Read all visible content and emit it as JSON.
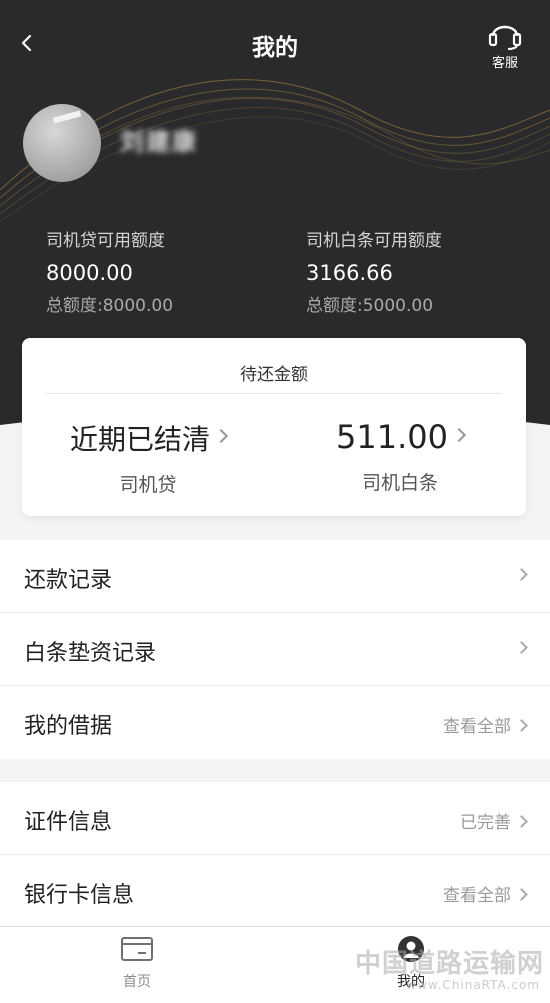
{
  "header": {
    "title": "我的",
    "service_label": "客服",
    "username": "刘建康"
  },
  "credit": {
    "loan": {
      "label": "司机贷可用额度",
      "value": "8000.00",
      "total": "总额度:8000.00"
    },
    "baitiao": {
      "label": "司机白条可用额度",
      "value": "3166.66",
      "total": "总额度:5000.00"
    }
  },
  "due": {
    "title": "待还金额",
    "loan": {
      "value": "近期已结清",
      "label": "司机贷"
    },
    "baitiao": {
      "value": "511.00",
      "label": "司机白条"
    }
  },
  "menu1": [
    {
      "label": "还款记录",
      "right": ""
    },
    {
      "label": "白条垫资记录",
      "right": ""
    },
    {
      "label": "我的借据",
      "right": "查看全部"
    }
  ],
  "menu2": [
    {
      "label": "证件信息",
      "right": "已完善"
    },
    {
      "label": "银行卡信息",
      "right": "查看全部"
    }
  ],
  "tabbar": {
    "home": "首页",
    "mine": "我的"
  },
  "watermark": {
    "main": "中国道路运输网",
    "sub": "www.ChinaRTA.com"
  },
  "colors": {
    "header_bg": "#2a2a2d",
    "wave": "#8a7338"
  }
}
